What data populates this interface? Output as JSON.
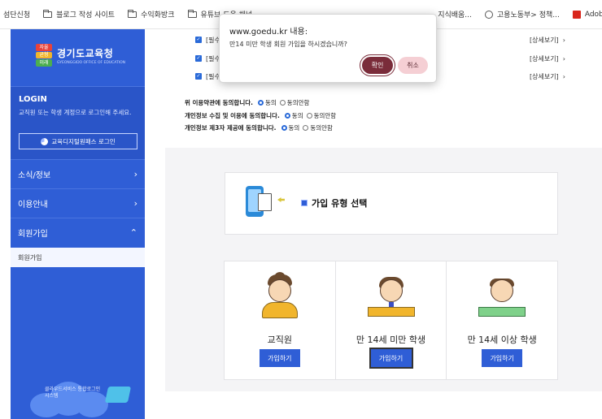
{
  "bookmarks": {
    "items": [
      {
        "label": "섬단신청",
        "icon": "none"
      },
      {
        "label": "블로그 작성 사이트",
        "icon": "folder-icon"
      },
      {
        "label": "수익화방크",
        "icon": "folder-icon"
      },
      {
        "label": "유튜브 도움 채널",
        "icon": "folder-icon"
      },
      {
        "label": "지식배움...",
        "icon": "none"
      },
      {
        "label": "고용노동부> 정책...",
        "icon": "globe-icon"
      },
      {
        "label": "Adobe Acrob",
        "icon": "pdf-icon"
      }
    ]
  },
  "sidebar": {
    "logo": {
      "badge_top": "자율",
      "badge_mid": "균형",
      "badge_bottom": "미래",
      "name": "경기도교육청",
      "eng": "GYEONGGIDO OFFICE OF EDUCATION"
    },
    "login": {
      "title": "LOGIN",
      "desc": "교직원 또는 학생 계정으로 로그인해 주세요.",
      "button": "교육디지털원패스 로그인"
    },
    "menu": [
      {
        "label": "소식/정보",
        "chevron": "›"
      },
      {
        "label": "이용안내",
        "chevron": "›"
      },
      {
        "label": "회원가입",
        "chevron": "⌃"
      }
    ],
    "submenu_item": "회원가입",
    "cloud_text": "클라우드서비스 통합로그인 시스템"
  },
  "main": {
    "agreements": [
      {
        "label": "[필수",
        "detail": "[상세보기]"
      },
      {
        "label": "[필수",
        "detail": "[상세보기]"
      },
      {
        "label": "[필수",
        "detail": "[상세보기]"
      }
    ],
    "consents": [
      {
        "question": "위 이용약관에 동의합니다.",
        "agree": "동의",
        "disagree": "동의안함"
      },
      {
        "question": "개인정보 수집 및 이용에 동의합니다.",
        "agree": "동의",
        "disagree": "동의안함"
      },
      {
        "question": "개인정보 제3자 제공에 동의합니다.",
        "agree": "동의",
        "disagree": "동의안함"
      }
    ],
    "type_title": "가입 유형 선택",
    "cards": [
      {
        "label": "교직원",
        "button": "가입하기"
      },
      {
        "label": "만 14세 미만 학생",
        "button": "가입하기"
      },
      {
        "label": "만 14세 이상 학생",
        "button": "가입하기"
      }
    ]
  },
  "dialog": {
    "origin": "www.goedu.kr 내용:",
    "message": "만14 미만 학생 회원 가입을 하시겠습니까?",
    "ok": "확인",
    "cancel": "취소"
  },
  "colors": {
    "sidebar": "#2f5ed6",
    "accent": "#2f5ed6",
    "dialog_ok": "#7a2c3a",
    "dialog_cancel": "#f5cfd4"
  }
}
